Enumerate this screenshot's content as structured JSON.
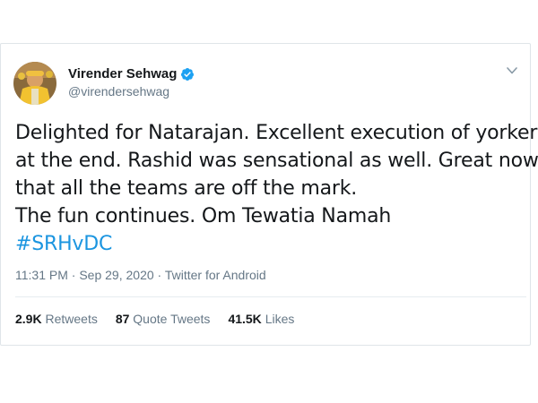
{
  "user": {
    "display_name": "Virender Sehwag",
    "handle": "@virendersehwag",
    "verified": true
  },
  "tweet": {
    "lines": [
      "Delighted for Natarajan. Excellent execution of  yorkers",
      "at the end. Rashid was sensational as well. Great now",
      "that all the teams are off the mark.",
      "The fun continues. Om Tewatia Namah"
    ],
    "hashtag": "#SRHvDC"
  },
  "meta": {
    "time": "11:31 PM",
    "separator1": " · ",
    "date": "Sep 29, 2020",
    "separator2": " · ",
    "source": "Twitter for Android"
  },
  "stats": {
    "retweets_count": "2.9K",
    "retweets_label": "Retweets",
    "quote_count": "87",
    "quote_label": "Quote Tweets",
    "likes_count": "41.5K",
    "likes_label": "Likes"
  },
  "colors": {
    "link": "#1b95e0",
    "verified": "#1da1f2",
    "secondary_text": "#657786",
    "primary_text": "#14171a"
  },
  "icons": {
    "verified": "verified-badge-icon",
    "chevron": "chevron-down-icon"
  }
}
